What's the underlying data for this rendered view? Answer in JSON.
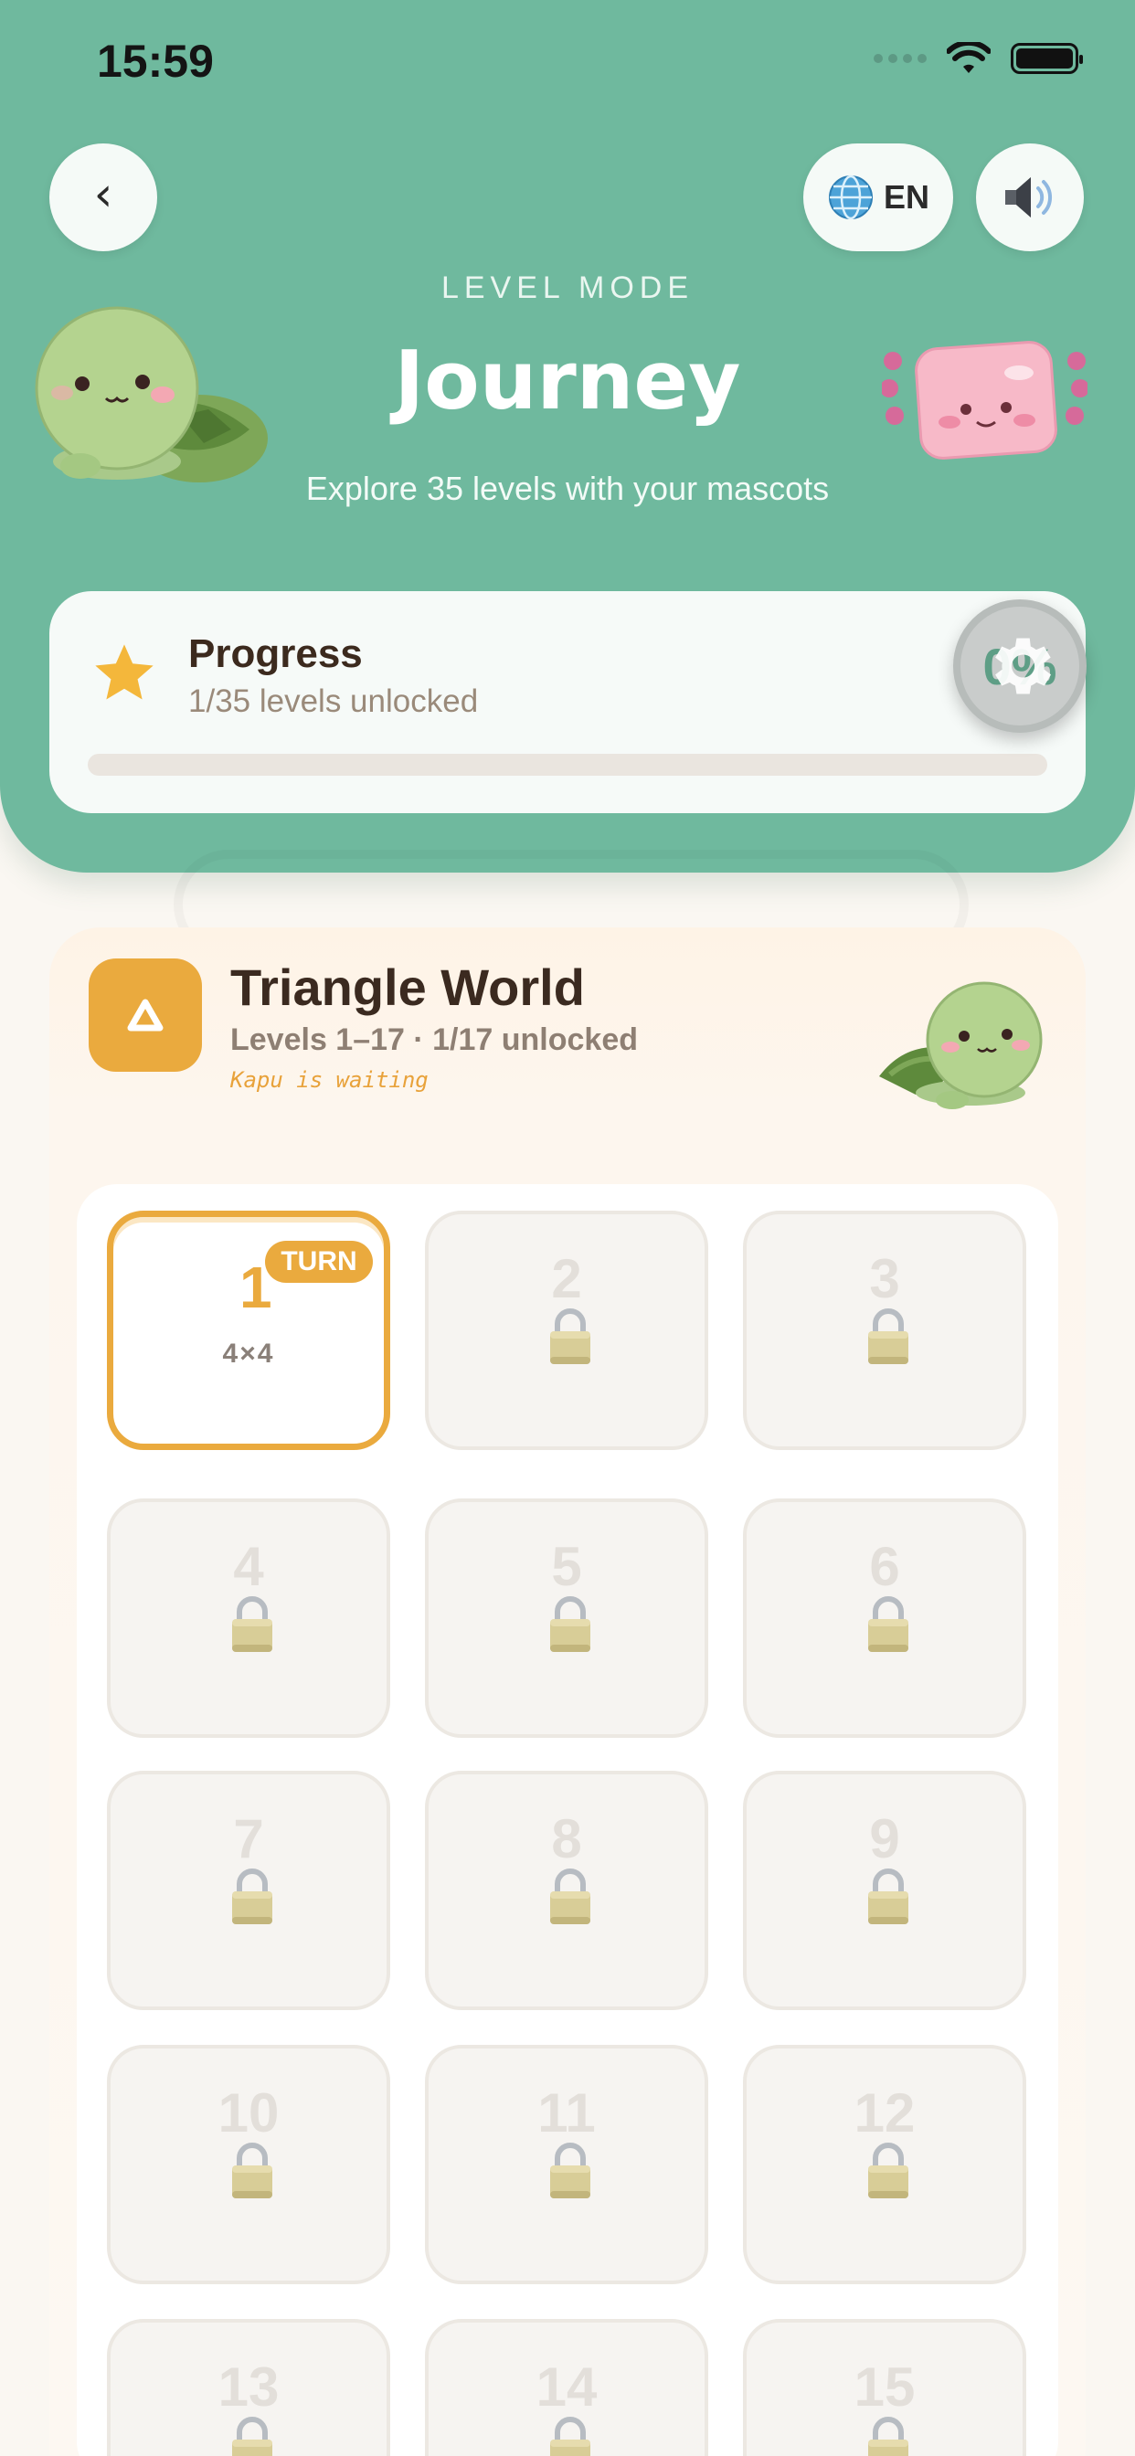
{
  "status_bar": {
    "time": "15:59"
  },
  "header": {
    "back_icon": "chevron-left-icon",
    "language_label": "EN",
    "language_icon": "globe-icon",
    "sound_icon": "speaker-icon",
    "kicker": "LEVEL MODE",
    "title": "Journey",
    "subtitle": "Explore 35 levels with your mascots"
  },
  "progress": {
    "title": "Progress",
    "subtitle": "1/35 levels unlocked",
    "percent_label": "0%",
    "fraction": 0.0
  },
  "world": {
    "title": "Triangle World",
    "subtitle": "Levels 1–17 · 1/17 unlocked",
    "hint": "Kapu is waiting",
    "icon": "triangle-icon"
  },
  "levels": [
    {
      "number": "1",
      "badge": "TURN",
      "size": "4×4",
      "locked": false
    },
    {
      "number": "2",
      "locked": true
    },
    {
      "number": "3",
      "locked": true
    },
    {
      "number": "4",
      "locked": true
    },
    {
      "number": "5",
      "locked": true
    },
    {
      "number": "6",
      "locked": true
    },
    {
      "number": "7",
      "locked": true
    },
    {
      "number": "8",
      "locked": true
    },
    {
      "number": "9",
      "locked": true
    },
    {
      "number": "10",
      "locked": true
    },
    {
      "number": "11",
      "locked": true
    },
    {
      "number": "12",
      "locked": true
    },
    {
      "number": "13",
      "locked": true
    },
    {
      "number": "14",
      "locked": true
    },
    {
      "number": "15",
      "locked": true
    }
  ],
  "colors": {
    "header_green": "#6FB99E",
    "accent_orange": "#EAAA3E",
    "card_bg": "#F6FAF8"
  }
}
